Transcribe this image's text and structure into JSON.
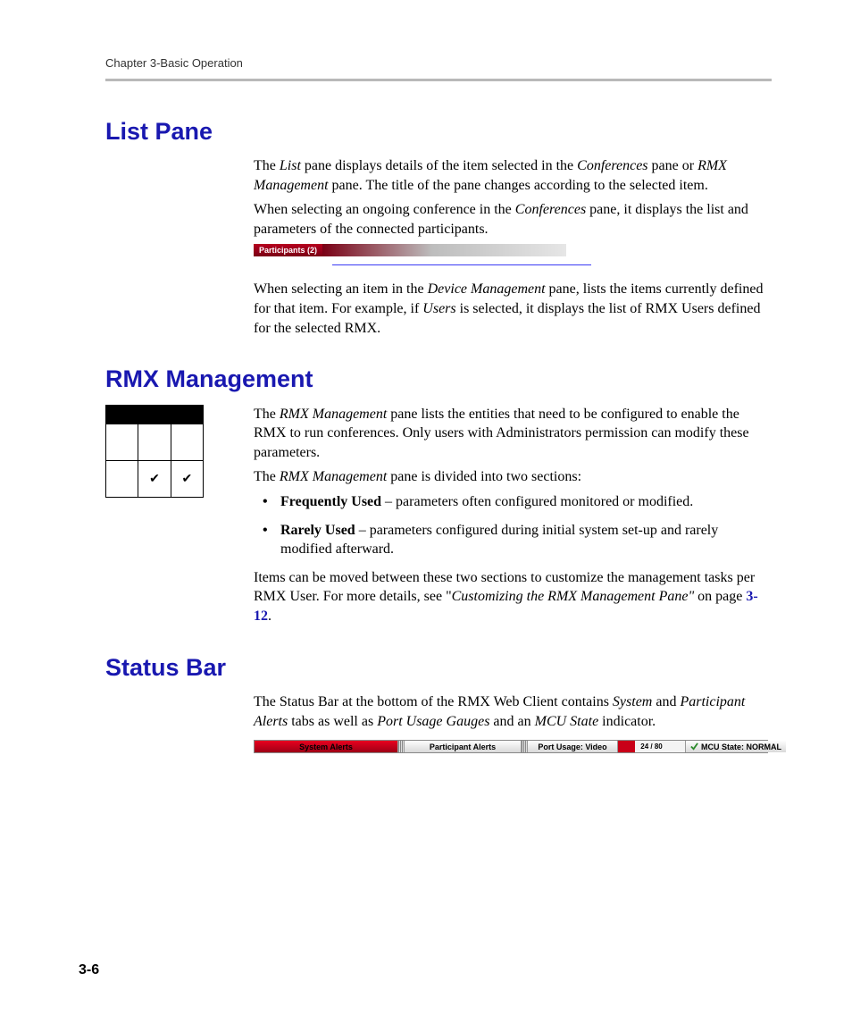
{
  "header": {
    "chapter_label": "Chapter 3-Basic Operation"
  },
  "list_pane": {
    "heading": "List Pane",
    "p1_a": "The ",
    "p1_b": "List",
    "p1_c": " pane displays details of the item selected in the ",
    "p1_d": "Conferences",
    "p1_e": " pane or ",
    "p1_f": "RMX Management",
    "p1_g": " pane. The title of the pane changes according to the selected item.",
    "p2_a": "When selecting an ongoing conference in the ",
    "p2_b": "Conferences",
    "p2_c": " pane, it displays the list and parameters of the connected participants.",
    "participants_label": "Participants (2)",
    "p3_a": "When selecting an item in the ",
    "p3_b": "Device Management",
    "p3_c": " pane, lists the items currently defined for that item. For example, if ",
    "p3_d": "Users",
    "p3_e": " is selected, it displays the list of RMX Users defined for the selected RMX."
  },
  "rmx_mgmt": {
    "heading": "RMX Management",
    "p1_a": "The ",
    "p1_b": "RMX Management",
    "p1_c": " pane lists the entities that need to be configured to enable the RMX to run conferences. Only users with Administrators permission can modify these parameters.",
    "p2_a": "The ",
    "p2_b": "RMX Management",
    "p2_c": " pane is divided into two sections:",
    "bullets": [
      {
        "term": "Frequently Used",
        "desc": " – parameters often configured monitored or modified."
      },
      {
        "term": "Rarely Used",
        "desc": " – parameters configured during initial system set-up and rarely modified afterward."
      }
    ],
    "p3_a": "Items can be moved between these two sections to customize the management tasks per RMX User. For more details, see \"",
    "p3_b": "Customizing the RMX Management Pane\"",
    "p3_c": " on page ",
    "p3_d": "3-12",
    "p3_e": ".",
    "side_check1": "✔",
    "side_check2": "✔"
  },
  "status_bar": {
    "heading": "Status Bar",
    "p1_a": "The Status Bar at the bottom of the RMX Web Client contains ",
    "p1_b": "System",
    "p1_c": " and ",
    "p1_d": "Participant Alerts",
    "p1_e": " tabs as well as ",
    "p1_f": "Port Usage Gauges",
    "p1_g": " and an ",
    "p1_h": "MCU State",
    "p1_i": " indicator.",
    "system_alerts": "System Alerts",
    "participant_alerts": "Participant Alerts",
    "port_usage_label": "Port Usage:   Video",
    "gauge_text": "24 / 80",
    "mcu_state": "MCU State: NORMAL"
  },
  "footer": {
    "page_number": "3-6"
  }
}
